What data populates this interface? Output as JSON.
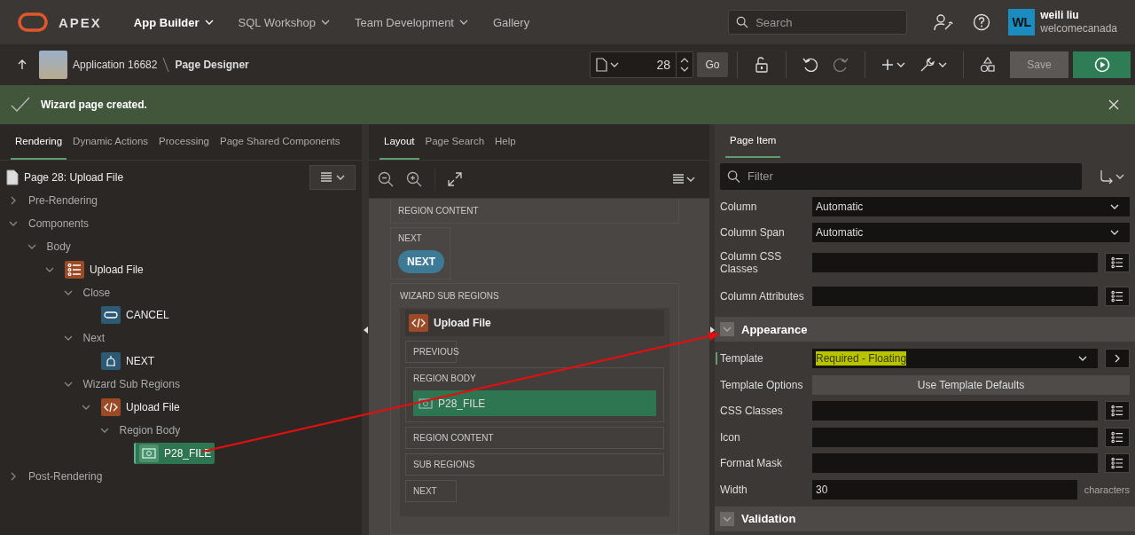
{
  "header": {
    "brand": "APEX",
    "nav": [
      {
        "label": "App Builder",
        "selected": true,
        "has_menu": true
      },
      {
        "label": "SQL Workshop",
        "selected": false,
        "has_menu": true
      },
      {
        "label": "Team Development",
        "selected": false,
        "has_menu": true
      },
      {
        "label": "Gallery",
        "selected": false,
        "has_menu": false
      }
    ],
    "search": {
      "placeholder": "Search"
    },
    "user": {
      "initials": "WL",
      "name": "weili liu",
      "workspace": "welcomecanada"
    }
  },
  "toolbar": {
    "application": "Application 16682",
    "page": "Page Designer",
    "page_number": "28",
    "go": "Go",
    "save": "Save"
  },
  "notification": {
    "message": "Wizard page created."
  },
  "left_panel": {
    "tabs": [
      {
        "label": "Rendering",
        "selected": true
      },
      {
        "label": "Dynamic Actions",
        "selected": false
      },
      {
        "label": "Processing",
        "selected": false
      },
      {
        "label": "Page Shared Components",
        "selected": false
      }
    ],
    "page_title": "Page 28: Upload File",
    "tree": [
      {
        "label": "Pre-Rendering",
        "kind": "folder",
        "expanded": false,
        "selected": false
      },
      {
        "label": "Components",
        "kind": "folder",
        "expanded": true,
        "selected": false,
        "children": [
          {
            "label": "Body",
            "kind": "folder",
            "expanded": true,
            "selected": false,
            "children": [
              {
                "label": "Upload File",
                "kind": "list_region",
                "expanded": true,
                "selected": false,
                "children": [
                  {
                    "label": "Close",
                    "kind": "folder",
                    "expanded": true,
                    "selected": false,
                    "children": [
                      {
                        "label": "CANCEL",
                        "kind": "button",
                        "selected": false
                      }
                    ]
                  },
                  {
                    "label": "Next",
                    "kind": "folder",
                    "expanded": true,
                    "selected": false,
                    "children": [
                      {
                        "label": "NEXT",
                        "kind": "next_button",
                        "selected": false
                      }
                    ]
                  },
                  {
                    "label": "Wizard Sub Regions",
                    "kind": "folder",
                    "expanded": true,
                    "selected": false,
                    "children": [
                      {
                        "label": "Upload File",
                        "kind": "code_region",
                        "expanded": true,
                        "selected": false,
                        "children": [
                          {
                            "label": "Region Body",
                            "kind": "folder",
                            "expanded": true,
                            "selected": false,
                            "children": [
                              {
                                "label": "P28_FILE",
                                "kind": "item",
                                "selected": true
                              }
                            ]
                          }
                        ]
                      }
                    ]
                  }
                ]
              }
            ]
          }
        ]
      },
      {
        "label": "Post-Rendering",
        "kind": "folder",
        "expanded": false,
        "selected": false
      }
    ]
  },
  "layout_panel": {
    "tabs": [
      {
        "label": "Layout",
        "selected": true
      },
      {
        "label": "Page Search",
        "selected": false
      },
      {
        "label": "Help",
        "selected": false
      }
    ],
    "top_region": "REGION CONTENT",
    "button_slot": {
      "label": "NEXT",
      "button": "NEXT"
    },
    "container": {
      "label": "WIZARD SUB REGIONS",
      "region_title": "Upload File",
      "slots": [
        {
          "label": "PREVIOUS",
          "kind": "small"
        },
        {
          "label": "REGION BODY",
          "kind": "wide",
          "item": {
            "label": "P28_FILE",
            "selected": true
          }
        },
        {
          "label": "REGION CONTENT",
          "kind": "wide"
        },
        {
          "label": "SUB REGIONS",
          "kind": "wide"
        },
        {
          "label": "NEXT",
          "kind": "small"
        }
      ]
    }
  },
  "property_panel": {
    "tabs": [
      {
        "label": "Page Item",
        "selected": true
      }
    ],
    "filter": {
      "placeholder": "Filter"
    },
    "properties": [
      {
        "kind": "select",
        "label": "Column",
        "value": "Automatic"
      },
      {
        "kind": "select",
        "label": "Column Span",
        "value": "Automatic"
      },
      {
        "kind": "text",
        "label": "Column CSS Classes",
        "has_list": true
      },
      {
        "kind": "text",
        "label": "Column Attributes",
        "has_list": true
      },
      {
        "kind": "group",
        "label": "Appearance",
        "expanded": true
      },
      {
        "kind": "select",
        "label": "Template",
        "value": "Required - Floating",
        "highlighted": true,
        "focused": true,
        "has_link": true
      },
      {
        "kind": "button",
        "label": "Template Options",
        "value": "Use Template Defaults"
      },
      {
        "kind": "text",
        "label": "CSS Classes",
        "has_list": true
      },
      {
        "kind": "text",
        "label": "Icon",
        "has_list": true
      },
      {
        "kind": "text",
        "label": "Format Mask",
        "has_list": true
      },
      {
        "kind": "text",
        "label": "Width",
        "value": "30",
        "has_list": false,
        "suffix": "characters"
      },
      {
        "kind": "group",
        "label": "Validation",
        "expanded": true
      }
    ]
  }
}
